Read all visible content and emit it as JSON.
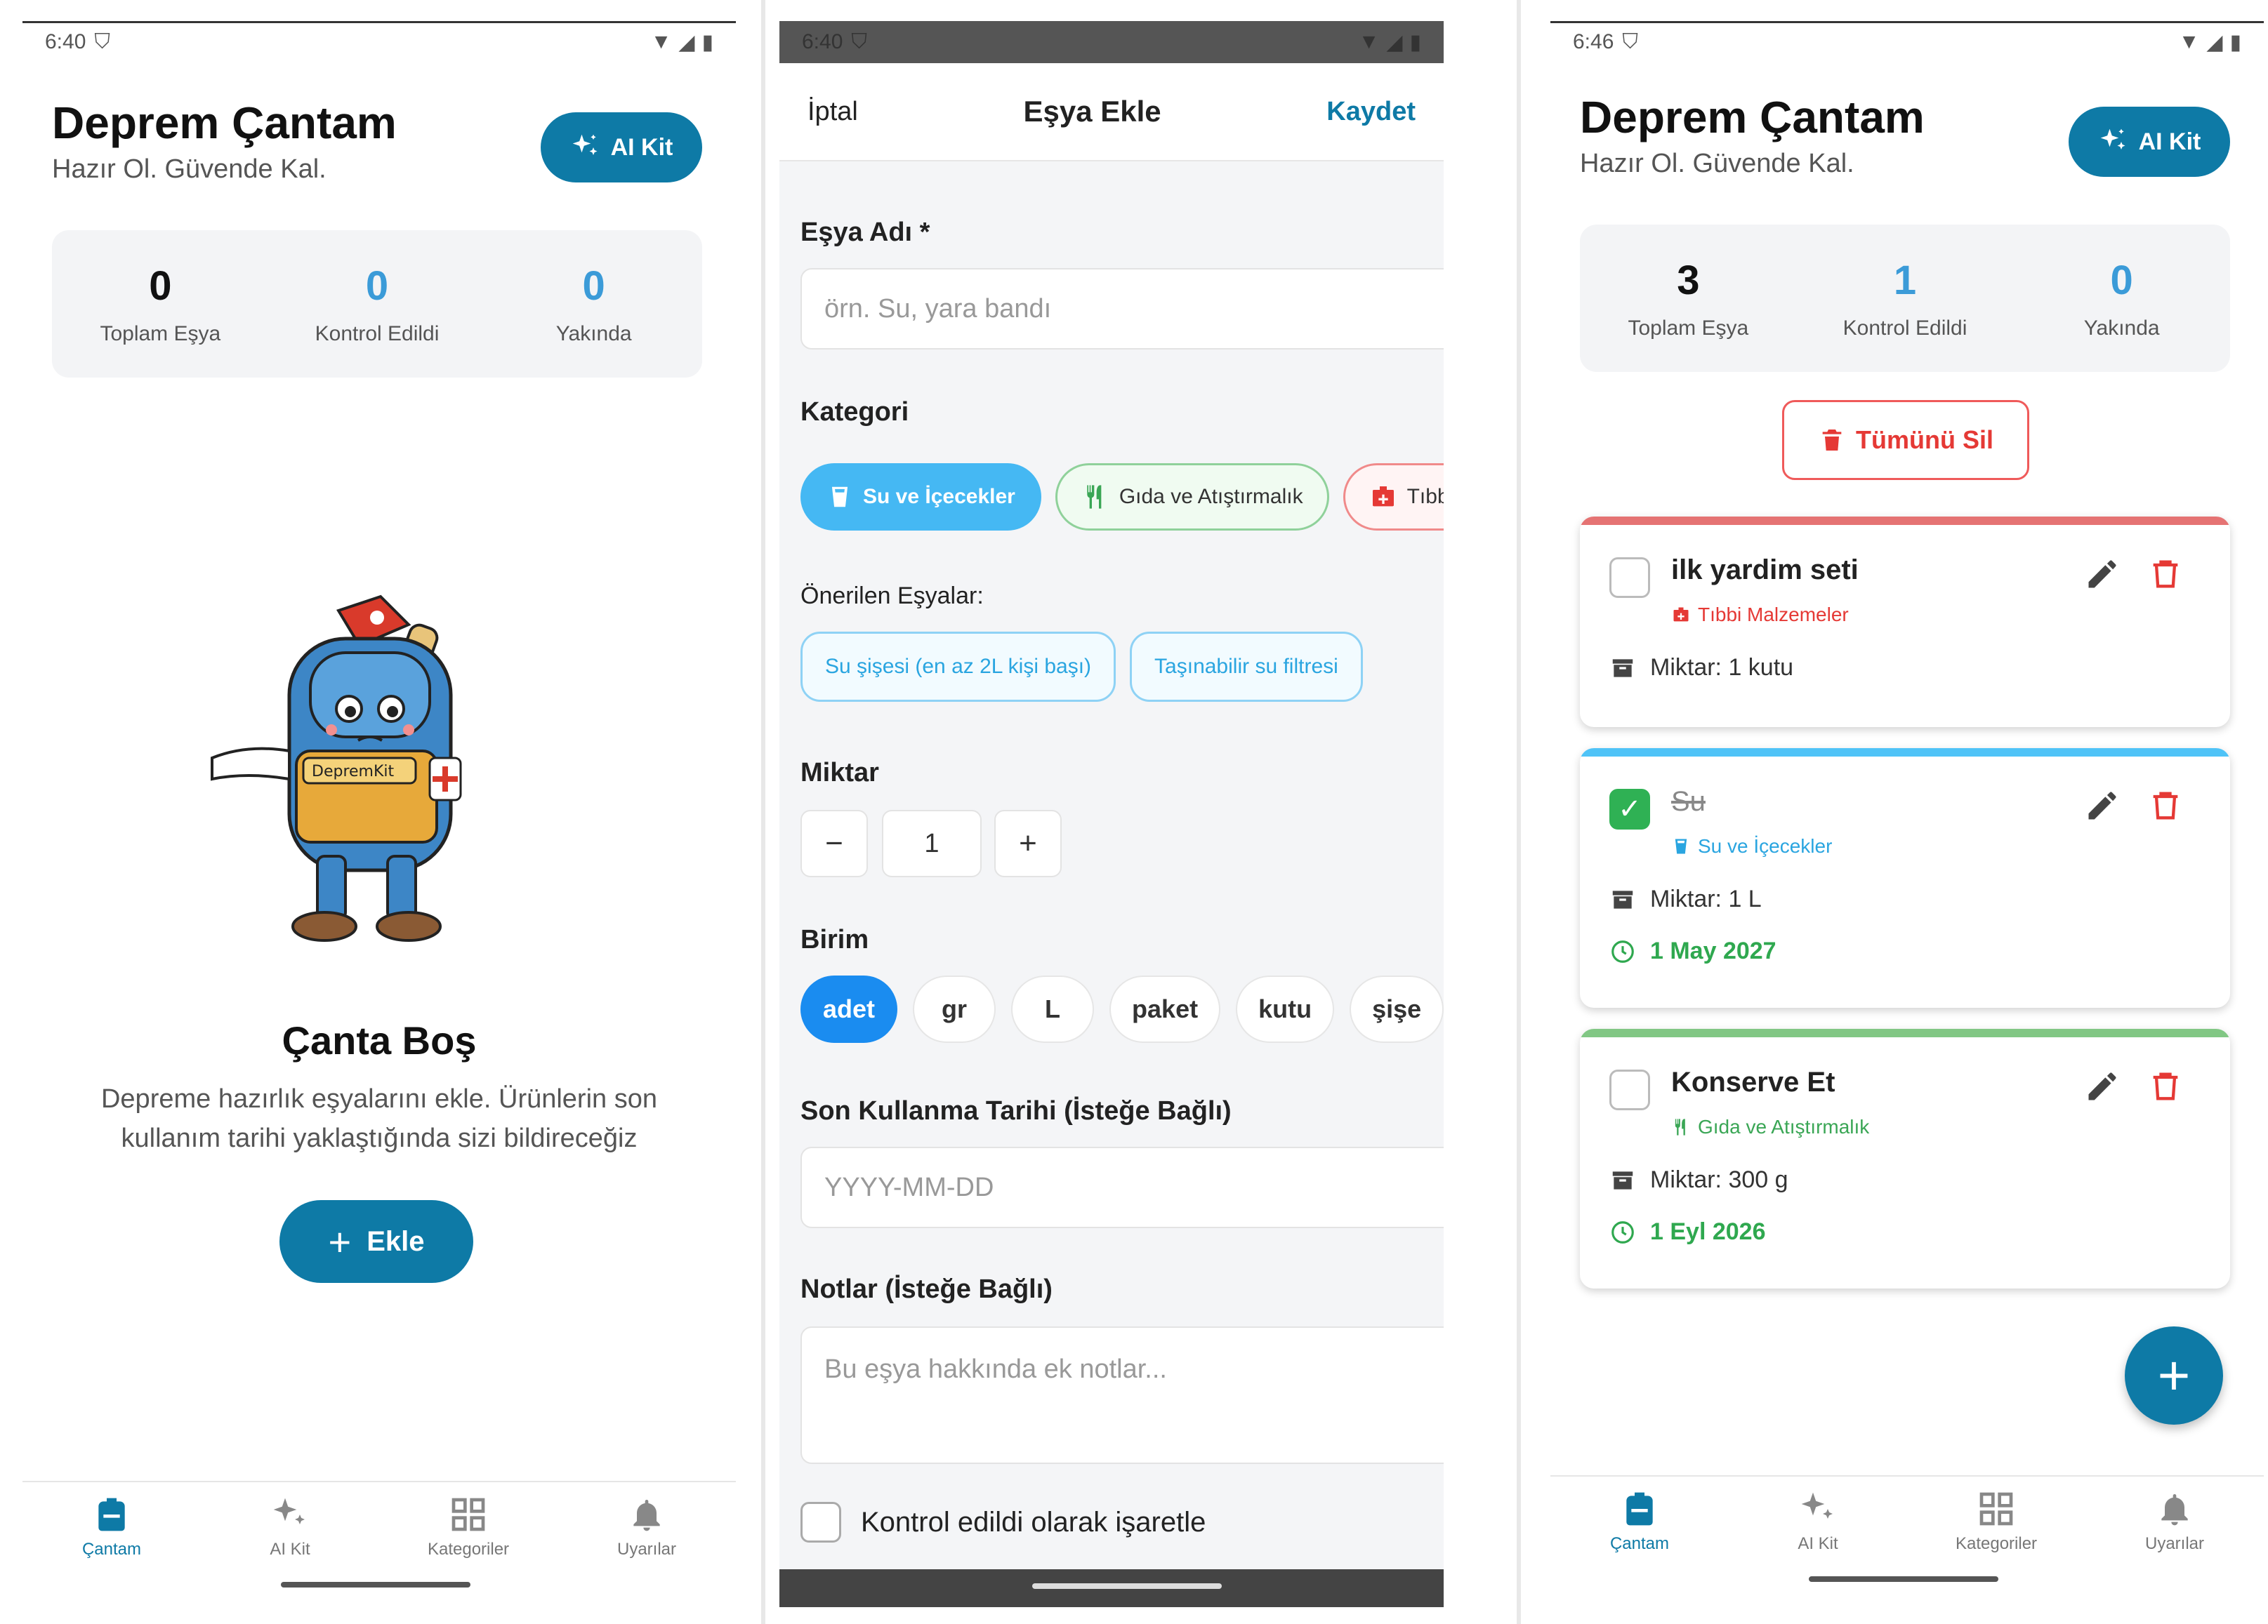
{
  "screens": {
    "home_empty": {
      "status_time": "6:40",
      "title": "Deprem Çantam",
      "subtitle": "Hazır Ol. Güvende Kal.",
      "ai_button": "AI Kit",
      "stats": [
        {
          "value": "0",
          "label": "Toplam Eşya"
        },
        {
          "value": "0",
          "label": "Kontrol Edildi"
        },
        {
          "value": "0",
          "label": "Yakında"
        }
      ],
      "mascot_label": "DepremKit",
      "empty_title": "Çanta Boş",
      "empty_text": "Depreme hazırlık eşyalarını ekle. Ürünlerin son kullanım tarihi yaklaştığında sizi bildireceğiz",
      "add_button": "Ekle"
    },
    "add_item": {
      "status_time": "6:40",
      "cancel": "İptal",
      "title": "Eşya Ekle",
      "save": "Kaydet",
      "name_label": "Eşya Adı *",
      "name_placeholder": "örn. Su, yara bandı",
      "category_label": "Kategori",
      "categories": [
        "Su ve İçecekler",
        "Gıda ve Atıştırmalık",
        "Tıbbi M"
      ],
      "suggested_label": "Önerilen Eşyalar:",
      "suggested": [
        "Su şişesi (en az 2L kişi başı)",
        "Taşınabilir su filtresi"
      ],
      "quantity_label": "Miktar",
      "quantity_value": "1",
      "unit_label": "Birim",
      "units": [
        "adet",
        "gr",
        "L",
        "paket",
        "kutu",
        "şişe"
      ],
      "expiry_label": "Son Kullanma Tarihi (İsteğe Bağlı)",
      "expiry_placeholder": "YYYY-MM-DD",
      "notes_label": "Notlar (İsteğe Bağlı)",
      "notes_placeholder": "Bu eşya hakkında ek notlar...",
      "checked_label": "Kontrol edildi olarak işaretle"
    },
    "home_list": {
      "status_time": "6:46",
      "title": "Deprem Çantam",
      "subtitle": "Hazır Ol. Güvende Kal.",
      "ai_button": "AI Kit",
      "stats": [
        {
          "value": "3",
          "label": "Toplam Eşya"
        },
        {
          "value": "1",
          "label": "Kontrol Edildi"
        },
        {
          "value": "0",
          "label": "Yakında"
        }
      ],
      "delete_all": "Tümünü Sil",
      "items": [
        {
          "name": "ilk yardim seti",
          "category": "Tıbbi Malzemeler",
          "quantity": "Miktar: 1 kutu",
          "date": "",
          "checked": false,
          "color": "#e57373"
        },
        {
          "name": "Su",
          "category": "Su ve İçecekler",
          "quantity": "Miktar: 1 L",
          "date": "1 May 2027",
          "checked": true,
          "color": "#4fc3f7"
        },
        {
          "name": "Konserve Et",
          "category": "Gıda ve Atıştırmalık",
          "quantity": "Miktar: 300 g",
          "date": "1 Eyl 2026",
          "checked": false,
          "color": "#81c784"
        }
      ]
    }
  },
  "nav": [
    "Çantam",
    "AI Kit",
    "Kategoriler",
    "Uyarılar"
  ],
  "colors": {
    "primary": "#0e7aa6",
    "accent_blue": "#3b9bd8",
    "danger": "#e53935",
    "success": "#2fa84f"
  }
}
